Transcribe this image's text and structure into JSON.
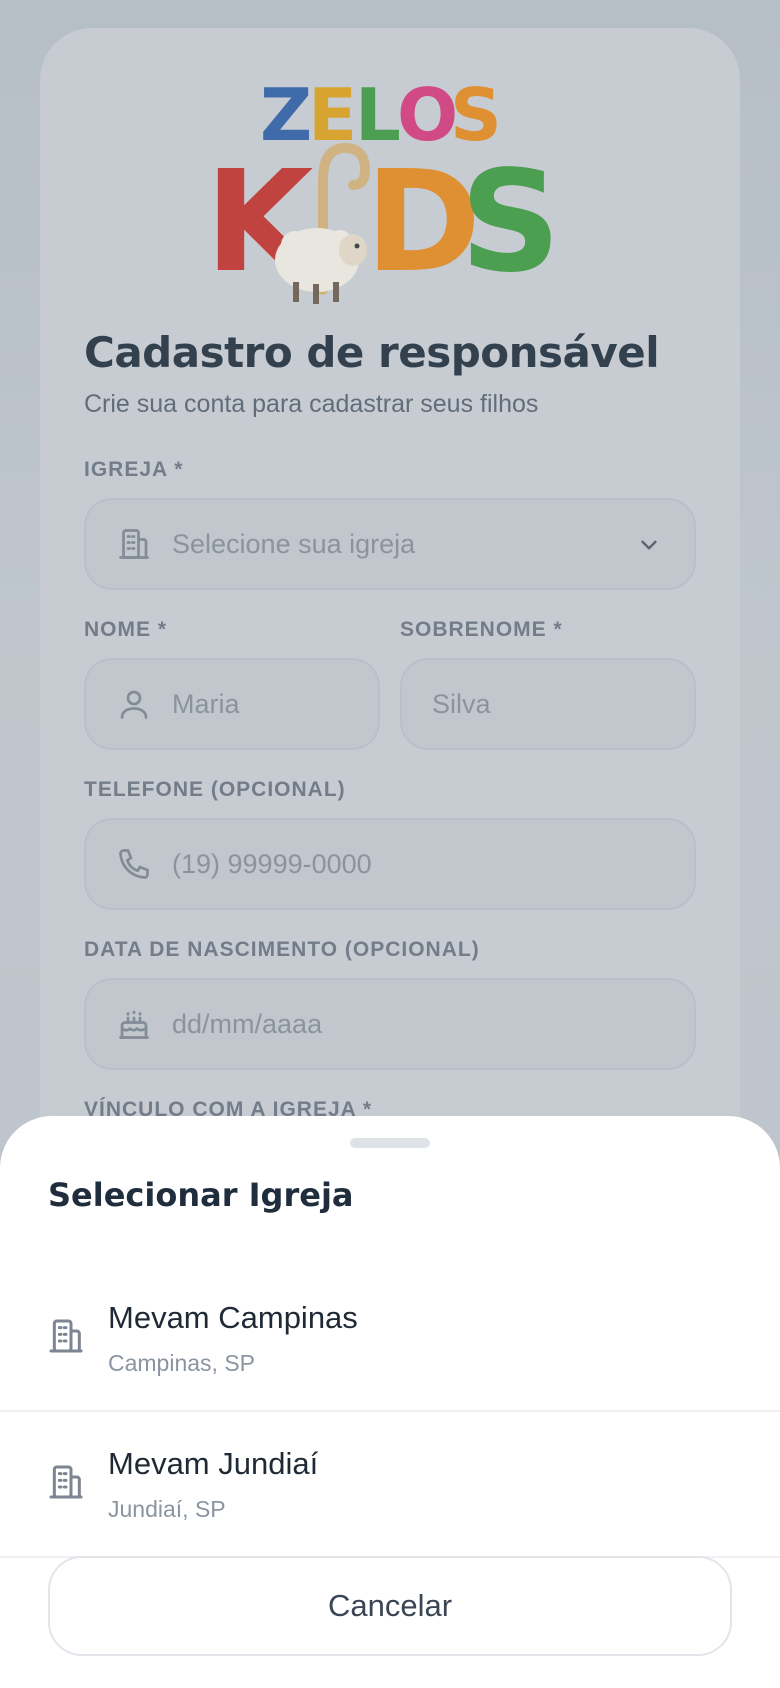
{
  "logo": {
    "line1": "ZELOS",
    "line2": "KIDS"
  },
  "form": {
    "title": "Cadastro de responsável",
    "subtitle": "Crie sua conta para cadastrar seus filhos",
    "church_label": "IGREJA *",
    "church_placeholder": "Selecione sua igreja",
    "first_name_label": "NOME *",
    "first_name_placeholder": "Maria",
    "last_name_label": "SOBRENOME *",
    "last_name_placeholder": "Silva",
    "phone_label": "TELEFONE (OPCIONAL)",
    "phone_placeholder": "(19) 99999-0000",
    "birth_label": "DATA DE NASCIMENTO (OPCIONAL)",
    "birth_placeholder": "dd/mm/aaaa",
    "link_label": "VÍNCULO COM A IGREJA *"
  },
  "sheet": {
    "title": "Selecionar Igreja",
    "options": [
      {
        "name": "Mevam Campinas",
        "location": "Campinas, SP"
      },
      {
        "name": "Mevam Jundiaí",
        "location": "Jundiaí, SP"
      }
    ],
    "cancel_label": "Cancelar"
  },
  "colors": {
    "logo_blue": "#2e5fa8",
    "logo_red": "#c62f2a",
    "logo_green": "#3c9a3f",
    "logo_pink": "#d9387c",
    "logo_orange": "#e88a1a",
    "title": "#1f2d3d"
  },
  "icons": [
    "building-icon",
    "person-icon",
    "phone-icon",
    "cake-icon",
    "chevron-down-icon"
  ]
}
